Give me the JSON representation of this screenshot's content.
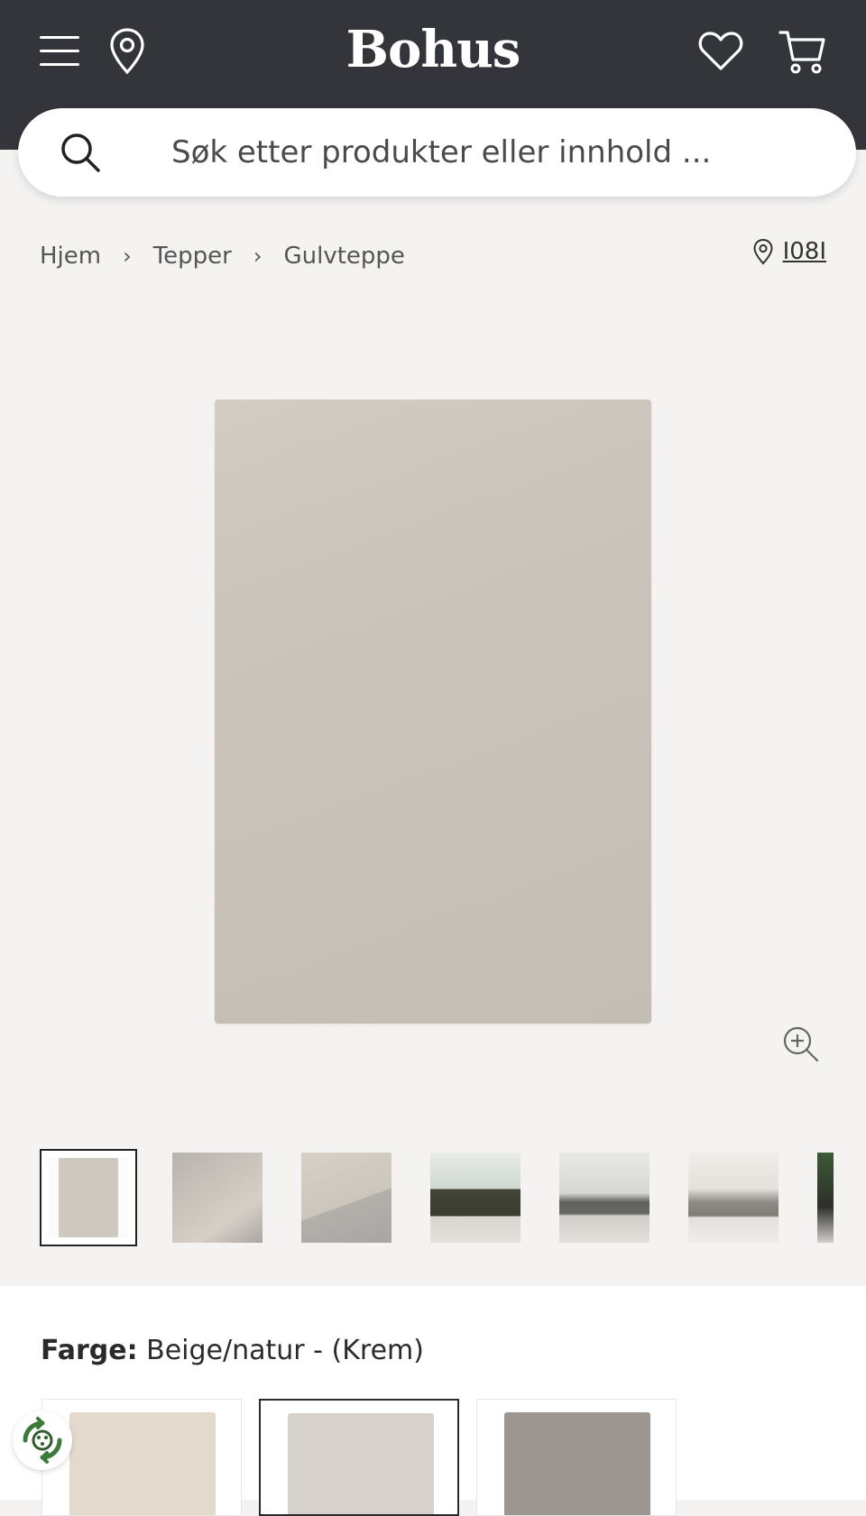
{
  "header": {
    "logo": "Bohus"
  },
  "search": {
    "placeholder": "Søk etter produkter eller innhold ..."
  },
  "breadcrumb": {
    "items": [
      "Hjem",
      "Tepper",
      "Gulvteppe"
    ],
    "separator": "›",
    "store_label": "I08I"
  },
  "product": {
    "rug_color": "#ccc5bc"
  },
  "thumbnails": [
    {
      "kind": "rug-flat",
      "active": true
    },
    {
      "kind": "rug-corner",
      "active": false
    },
    {
      "kind": "rug-edge",
      "active": false
    },
    {
      "kind": "living-room-green-sofa",
      "active": false
    },
    {
      "kind": "living-room-window",
      "active": false
    },
    {
      "kind": "armchair-room",
      "active": false
    },
    {
      "kind": "plant-partial",
      "active": false
    }
  ],
  "color_selector": {
    "label": "Farge:",
    "value": "Beige/natur - (Krem)",
    "swatches": [
      {
        "color": "#e3d9cc",
        "active": false
      },
      {
        "color": "#d6d1cb",
        "active": true
      },
      {
        "color": "#9c9690",
        "active": false
      }
    ]
  },
  "icons": {
    "menu": "menu-icon",
    "location": "location-pin-icon",
    "wishlist": "heart-icon",
    "cart": "cart-icon",
    "search": "search-icon",
    "zoom": "zoom-in-icon",
    "eco": "recycle-badge-icon"
  },
  "colors": {
    "header_bg": "#34353a",
    "page_bg": "#f4f3f2"
  }
}
